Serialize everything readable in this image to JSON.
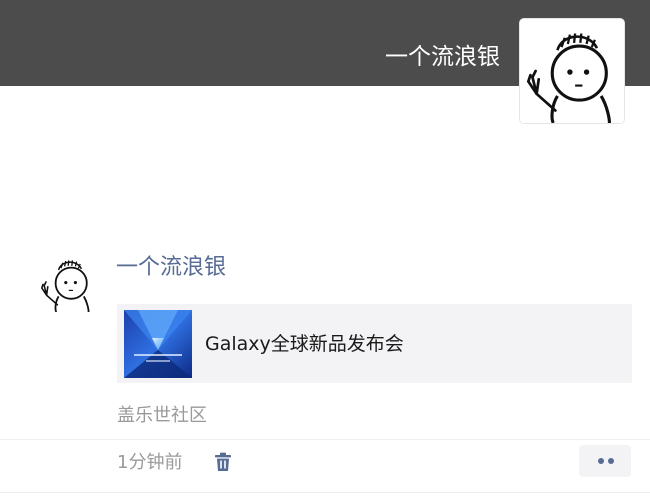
{
  "cover": {
    "username": "一个流浪银",
    "background_color": "#4c4c4c",
    "avatar_icon": "cartoon-face-waving-icon"
  },
  "post": {
    "author": "一个流浪银",
    "author_color": "#576b95",
    "avatar_icon": "cartoon-face-waving-icon",
    "link": {
      "title": "Galaxy全球新品发布会",
      "thumbnail_icon": "galaxy-event-thumbnail"
    },
    "source": "盖乐世社区",
    "time": "1分钟前",
    "delete_icon": "trash-icon",
    "more_icon": "more-dots-icon"
  }
}
